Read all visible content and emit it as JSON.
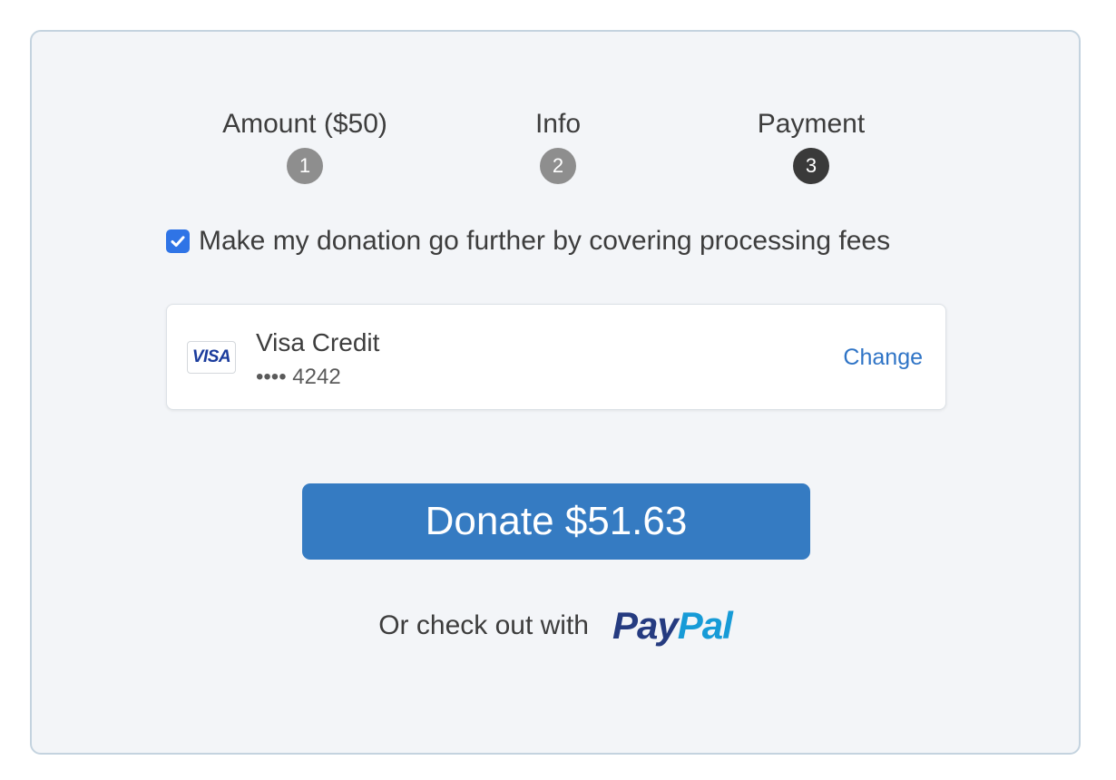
{
  "steps": [
    {
      "label": "Amount ($50)",
      "number": "1",
      "active": false
    },
    {
      "label": "Info",
      "number": "2",
      "active": false
    },
    {
      "label": "Payment",
      "number": "3",
      "active": true
    }
  ],
  "fee_option": {
    "label": "Make my donation go further by covering processing fees",
    "checked": true
  },
  "payment_method": {
    "brand_logo_text": "VISA",
    "name": "Visa Credit",
    "masked_number": "•••• 4242",
    "change_label": "Change"
  },
  "donate_button": {
    "label": "Donate $51.63"
  },
  "alternative": {
    "text": "Or check out with",
    "paypal_pay": "Pay",
    "paypal_pal": "Pal"
  },
  "colors": {
    "accent": "#357bc2",
    "link": "#2f74c6",
    "paypal_dark": "#253b80",
    "paypal_light": "#179bd7",
    "step_active": "#3a3a3a",
    "step_inactive": "#8e8e8e",
    "checkbox": "#2f74e6"
  }
}
